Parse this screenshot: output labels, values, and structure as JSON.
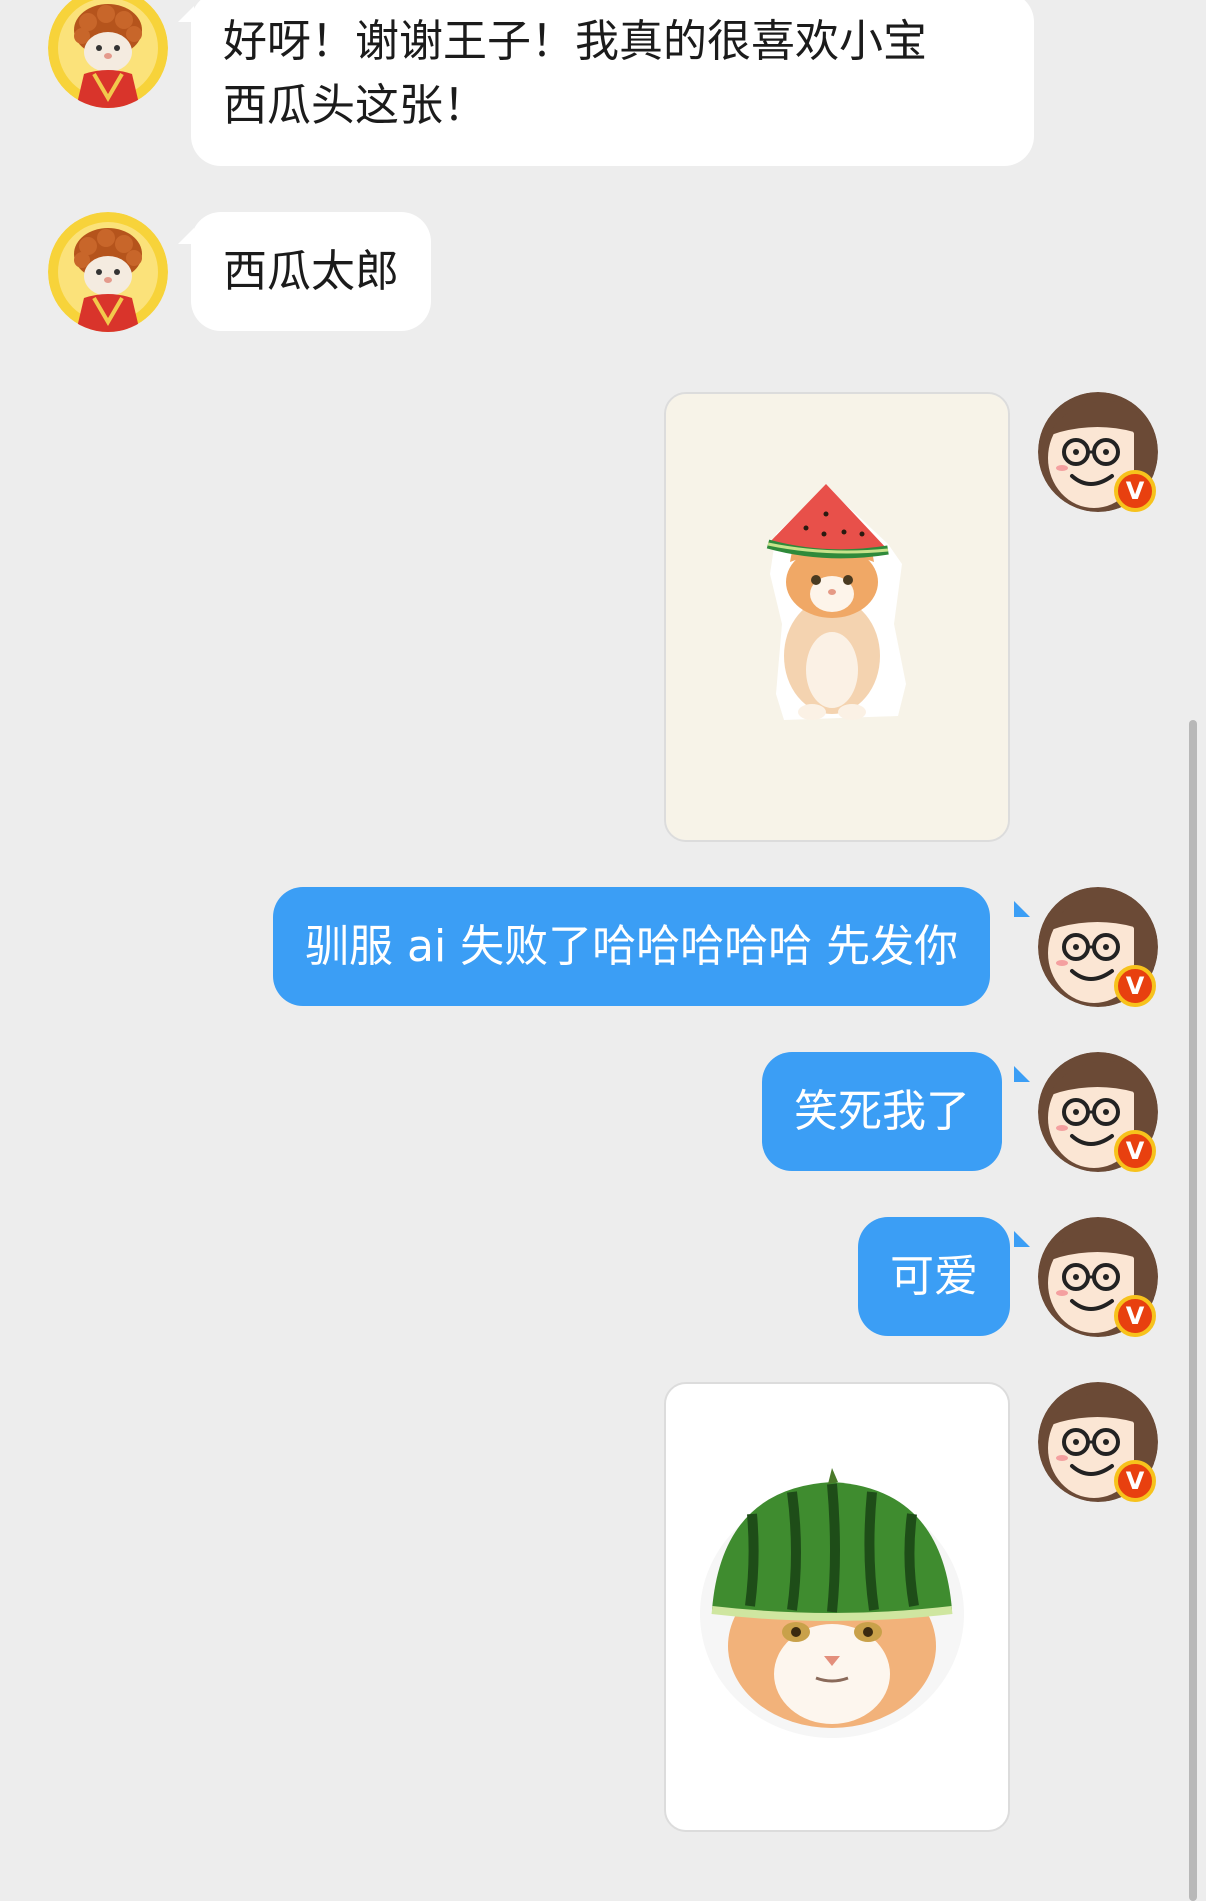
{
  "messages": [
    {
      "sender": "other",
      "type": "text",
      "lines": [
        "好呀！谢谢王子！我真的很喜欢小宝",
        "西瓜头这张！"
      ]
    },
    {
      "sender": "other",
      "type": "text",
      "text": "西瓜太郎"
    },
    {
      "sender": "me",
      "type": "image",
      "image": "cat-with-watermelon-slice-hat-sticker"
    },
    {
      "sender": "me",
      "type": "text",
      "text": "驯服 ai 失败了哈哈哈哈哈 先发你"
    },
    {
      "sender": "me",
      "type": "text",
      "text": "笑死我了"
    },
    {
      "sender": "me",
      "type": "text",
      "text": "可爱"
    },
    {
      "sender": "me",
      "type": "image",
      "image": "cat-with-watermelon-helmet-sticker"
    }
  ],
  "avatars": {
    "other": "cat-in-costume-avatar",
    "me": "cartoon-girl-with-glasses-avatar",
    "me_badge": "V"
  },
  "colors": {
    "background": "#ededed",
    "bubble_in": "#ffffff",
    "bubble_out": "#3b9ef5",
    "badge": "#e8400f",
    "badge_ring": "#f7c21c"
  }
}
